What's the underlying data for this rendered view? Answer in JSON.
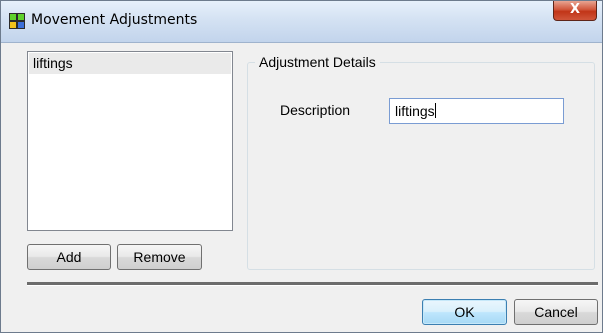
{
  "window": {
    "title": "Movement Adjustments",
    "close_label": "X"
  },
  "list": {
    "items": [
      {
        "label": "liftings"
      }
    ]
  },
  "list_buttons": {
    "add_label": "Add",
    "remove_label": "Remove"
  },
  "details": {
    "group_title": "Adjustment Details",
    "description_label": "Description",
    "description_value": "liftings"
  },
  "footer": {
    "ok_label": "OK",
    "cancel_label": "Cancel"
  },
  "colors": {
    "window_bg": "#f0f0f0",
    "titlebar": "#c2d4ec",
    "close_button": "#c13518",
    "ok_button": "#bee6fd"
  },
  "icons": {
    "app": "grid-app-icon",
    "close": "close-icon"
  }
}
